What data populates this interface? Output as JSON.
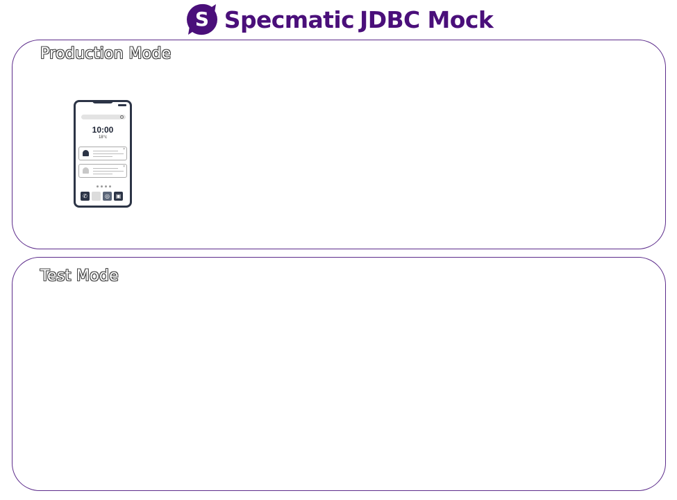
{
  "header": {
    "brand": "Specmatic",
    "product": "JDBC Mock",
    "brand_color": "#4a0f7a"
  },
  "panels": {
    "production": {
      "title": "Production Mode"
    },
    "test": {
      "title": "Test Mode"
    }
  },
  "phone": {
    "time": "10:00",
    "temperature": "18°c",
    "icons": [
      "phone-icon",
      "blank-app-icon",
      "whatsapp-icon",
      "instagram-icon"
    ]
  },
  "colors": {
    "panel_border": "#5b2a8a",
    "phone_frame": "#2c3446"
  }
}
